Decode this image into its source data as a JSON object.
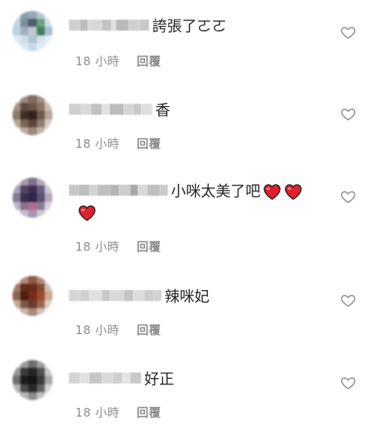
{
  "comments": [
    {
      "username": "",
      "text": "誇張了ㄛㄛ",
      "time": "18 小時",
      "reply_label": "回覆",
      "hearts": 0,
      "avatar_colors": [
        "#d9e4ec",
        "#8aa0b0",
        "#9aa8b5",
        "#b8c6d4",
        "#e8eef3",
        "#c6d4de",
        "#7c8d9a",
        "#4d5d68",
        "#6aa37e",
        "#d2dde5",
        "#bcd0e0",
        "#9fb0c0",
        "#c0c9d2",
        "#3f7f5a",
        "#a9bfd3",
        "#e0e9f2",
        "#cfdde9",
        "#b0c4d8",
        "#d7e3ee",
        "#e6eef6",
        "#f0f5f9",
        "#dce7f2",
        "#c9d9ea",
        "#e3ecf5",
        "#f2f6fa"
      ]
    },
    {
      "username": "",
      "text": "香",
      "time": "18 小時",
      "reply_label": "回覆",
      "hearts": 0,
      "avatar_colors": [
        "#d8cfc8",
        "#9a8a7e",
        "#7e6a5c",
        "#a08e80",
        "#e2dad3",
        "#a39283",
        "#5d4a3e",
        "#6b5446",
        "#8a7566",
        "#c9bdb2",
        "#8b7a6c",
        "#3f2f26",
        "#2e231c",
        "#6e5a4c",
        "#b5a698",
        "#b7a99b",
        "#7a6656",
        "#5a473b",
        "#8f7b6c",
        "#d5cbc1",
        "#e6dfd8",
        "#b9ab9e",
        "#9c8a7b",
        "#c3b5a8",
        "#eee8e2"
      ]
    },
    {
      "username": "",
      "text": "小咪太美了吧",
      "time": "18 小時",
      "reply_label": "回覆",
      "hearts": 3,
      "avatar_colors": [
        "#dcd7dc",
        "#a79ca8",
        "#7f7390",
        "#b2a8b6",
        "#e6e2e7",
        "#a9a0b2",
        "#4f4466",
        "#3a2f52",
        "#6a5f7e",
        "#cfc8d4",
        "#857b92",
        "#3b2d54",
        "#2f2548",
        "#5b4f72",
        "#b3a9bb",
        "#bdb4c4",
        "#8a6f86",
        "#b06f8f",
        "#8b7d97",
        "#d9d3dd",
        "#e8e4ea",
        "#c4bccb",
        "#a698ad",
        "#cfc7d5",
        "#f0edf2"
      ]
    },
    {
      "username": "",
      "text": "辣咪妃",
      "time": "18 小時",
      "reply_label": "回覆",
      "hearts": 0,
      "avatar_colors": [
        "#e4d4cc",
        "#b28a78",
        "#8d5a44",
        "#b08878",
        "#ecdfd8",
        "#a57a66",
        "#5e2c1e",
        "#6b2a1c",
        "#8a4c36",
        "#d4bfb4",
        "#8f6350",
        "#4a1e14",
        "#7a2a18",
        "#a0482c",
        "#c9a894",
        "#c4a898",
        "#7a5848",
        "#6a3a2c",
        "#9a6650",
        "#e0cdc3",
        "#efe4de",
        "#c8b4a8",
        "#a88a7c",
        "#d3c0b5",
        "#f4ede9"
      ]
    },
    {
      "username": "",
      "text": "好正",
      "time": "18 小時",
      "reply_label": "回覆",
      "hearts": 0,
      "avatar_colors": [
        "#dcdcdc",
        "#9c9c9c",
        "#6e6e6e",
        "#a0a0a0",
        "#e8e8e8",
        "#9a9a9a",
        "#3c3c3c",
        "#262626",
        "#505050",
        "#c8c8c8",
        "#707070",
        "#1c1c1c",
        "#141414",
        "#3a3a3a",
        "#a8a8a8",
        "#b4b4b4",
        "#4c4c4c",
        "#2a2a2a",
        "#606060",
        "#d2d2d2",
        "#e6e6e6",
        "#b8b8b8",
        "#8c8c8c",
        "#c4c4c4",
        "#f0f0f0"
      ]
    }
  ],
  "username_blur_colors": [
    [
      "#cfcfcf",
      "#bdbdbd",
      "#d8d8d8",
      "#c4c4c4",
      "#e0e0e0",
      "#b9b9b9",
      "#d0d0d0",
      "#c8c8c8"
    ],
    [
      "#cfcfcf",
      "#d9d9d9",
      "#c2c2c2",
      "#e2e2e2",
      "#bcbcbc",
      "#d4d4d4",
      "#c9c9c9",
      "#dedede"
    ],
    [
      "#c7c7c7",
      "#bdbdbd",
      "#d3d3d3",
      "#c0c0c0",
      "#b6b6b6",
      "#cdcdcd",
      "#a9a9a9",
      "#d8d8d8",
      "#bfbfbf",
      "#cacaca"
    ],
    [
      "#d6d6d6",
      "#cfcfcf",
      "#e0e0e0",
      "#c8c8c8",
      "#d9d9d9",
      "#c4c4c4",
      "#dcdcdc",
      "#cccccc",
      "#d2d2d2"
    ],
    [
      "#d4d4d4",
      "#e2e2e2",
      "#c6c6c6",
      "#dadada",
      "#cfcfcf",
      "#e4e4e4",
      "#c9c9c9"
    ]
  ],
  "colors": {
    "text": "#262626",
    "meta": "#8e8e8e",
    "heart_outline": "#8e8e8e",
    "emoji_heart": "#e0202c"
  },
  "icons": {
    "like": "heart-outline-icon",
    "emoji": "red-heart-emoji-icon"
  }
}
